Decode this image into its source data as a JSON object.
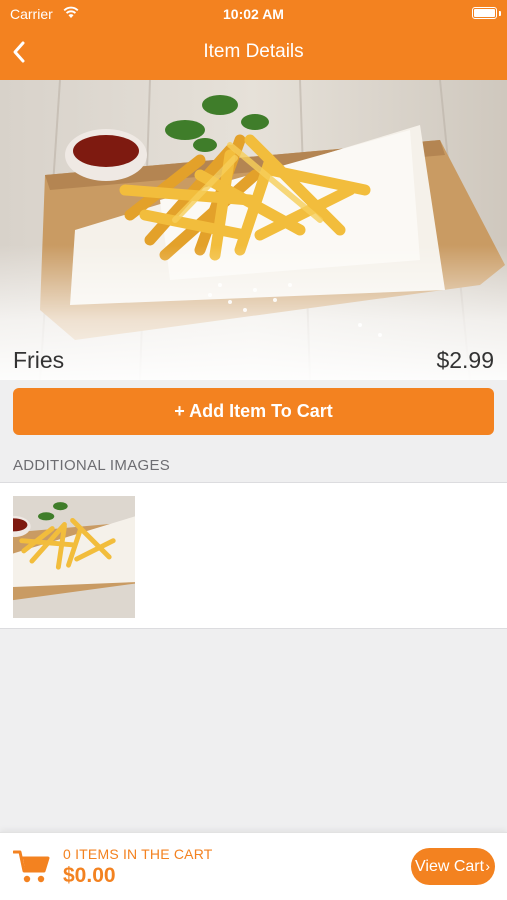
{
  "colors": {
    "accent": "#f38220",
    "background": "#efeff0",
    "text": "#333333"
  },
  "status_bar": {
    "carrier": "Carrier",
    "time": "10:02 AM"
  },
  "header": {
    "title": "Item Details",
    "back_icon": "chevron-left-icon"
  },
  "item": {
    "name": "Fries",
    "price": "$2.99"
  },
  "add_to_cart": {
    "icon": "plus-icon",
    "label": "+ Add Item To Cart"
  },
  "additional_images": {
    "heading": "ADDITIONAL IMAGES"
  },
  "cart_bar": {
    "icon": "cart-icon",
    "count_text": "0 ITEMS IN THE CART",
    "total": "$0.00",
    "view_cart_label": "View Cart",
    "view_cart_chevron": "›"
  }
}
